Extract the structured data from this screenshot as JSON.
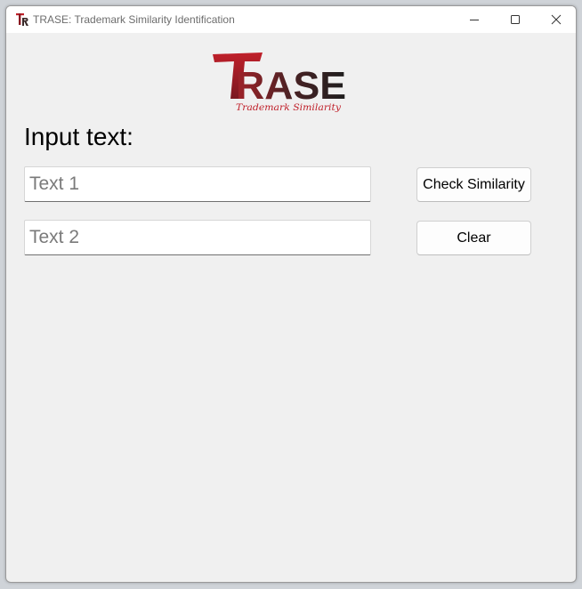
{
  "window": {
    "title": "TRASE: Trademark Similarity Identification",
    "icon": "trase-app-icon",
    "controls": [
      "minimize-icon",
      "maximize-icon",
      "close-icon"
    ]
  },
  "logo": {
    "brand_name": "TRASE",
    "tagline": "Trademark Similarity",
    "colors": {
      "accent_red": "#c0202a",
      "dark": "#1e1e1e"
    }
  },
  "form": {
    "label": "Input text:",
    "text1_placeholder": "Text 1",
    "text1_value": "",
    "text2_placeholder": "Text 2",
    "text2_value": ""
  },
  "buttons": {
    "check_label": "Check Similarity",
    "clear_label": "Clear"
  }
}
